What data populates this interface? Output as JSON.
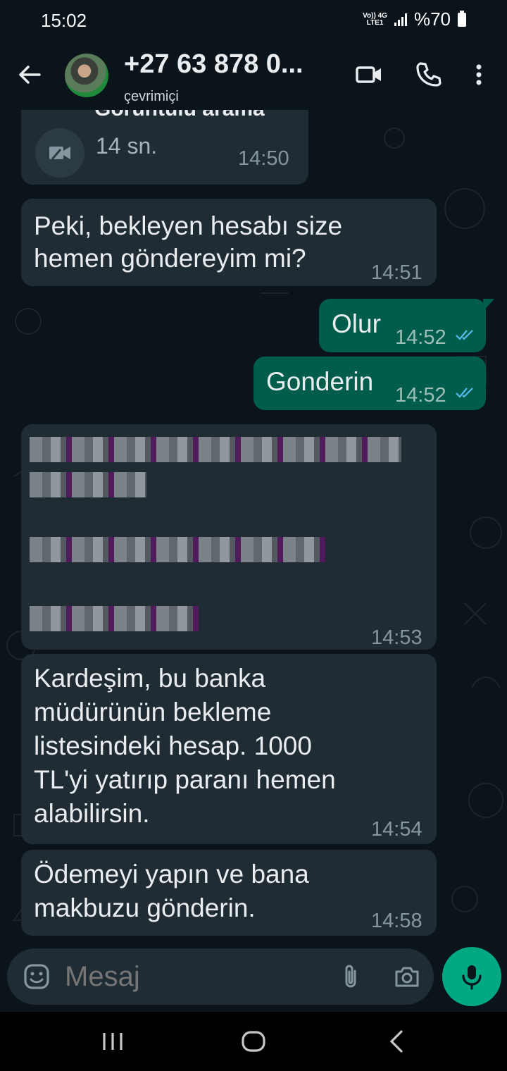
{
  "status_bar": {
    "time": "15:02",
    "network_top": "Vo)) 4G",
    "network_bottom": "LTE1",
    "battery": "%70"
  },
  "header": {
    "contact_name": "+27 63 878 0...",
    "status": "çevrimiçi"
  },
  "messages": [
    {
      "type": "call",
      "direction": "in",
      "title": "Görüntülü arama",
      "duration": "14 sn.",
      "time": "14:50"
    },
    {
      "type": "text",
      "direction": "in",
      "lines": [
        "Peki, bekleyen hesabı size",
        "hemen göndereyim mi?"
      ],
      "time": "14:51"
    },
    {
      "type": "text",
      "direction": "out",
      "lines": [
        "Olur"
      ],
      "time": "14:52",
      "status": "read"
    },
    {
      "type": "text",
      "direction": "out",
      "lines": [
        "Gonderin"
      ],
      "time": "14:52",
      "status": "read"
    },
    {
      "type": "redacted",
      "direction": "in",
      "time": "14:53"
    },
    {
      "type": "text",
      "direction": "in",
      "lines": [
        "Kardeşim, bu banka",
        "müdürünün bekleme",
        "listesindeki hesap. 1000",
        "TL'yi yatırıp paranı hemen",
        "alabilirsin."
      ],
      "time": "14:54"
    },
    {
      "type": "text",
      "direction": "in",
      "lines": [
        "Ödemeyi yapın ve bana",
        "makbuzu gönderin."
      ],
      "time": "14:58"
    }
  ],
  "composer": {
    "placeholder": "Mesaj"
  },
  "colors": {
    "background": "#0b141a",
    "incoming_bubble": "#1f2c33",
    "outgoing_bubble": "#005c4b",
    "accent": "#00a884",
    "read_ticks": "#53bdeb"
  },
  "icons": [
    "back-arrow-icon",
    "video-call-icon",
    "phone-icon",
    "more-vert-icon",
    "emoji-icon",
    "attach-icon",
    "camera-icon",
    "mic-icon",
    "recent-apps-icon",
    "home-icon",
    "nav-back-icon"
  ]
}
